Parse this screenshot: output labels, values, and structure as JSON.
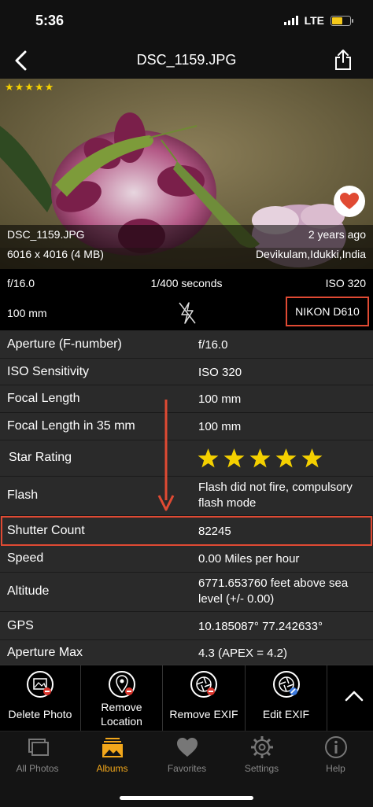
{
  "status_bar": {
    "time": "5:36",
    "network": "LTE",
    "battery_level": 0.6
  },
  "nav": {
    "title": "DSC_1159.JPG",
    "back_icon": "chevron-left-icon",
    "share_icon": "share-icon"
  },
  "photo": {
    "stars": "★★★★★",
    "filename": "DSC_1159.JPG",
    "dimensions": "6016 x 4016 (4 MB)",
    "age": "2 years ago",
    "location": "Devikulam,Idukki,India",
    "favorite_icon": "heart-icon"
  },
  "summary": {
    "aperture": "f/16.0",
    "shutter": "1/400 seconds",
    "iso": "ISO 320",
    "focal": "100 mm",
    "flash_icon": "flash-off-icon",
    "camera": "NIKON D610"
  },
  "exif": [
    {
      "label": "Aperture (F-number)",
      "value": "f/16.0"
    },
    {
      "label": "ISO Sensitivity",
      "value": "ISO 320"
    },
    {
      "label": "Focal Length",
      "value": "100 mm"
    },
    {
      "label": "Focal Length in 35 mm",
      "value": "100 mm"
    },
    {
      "label": "Star Rating",
      "value": "",
      "rating": 5,
      "rating_max": 5
    },
    {
      "label": "Flash",
      "value": "Flash did not fire, compulsory flash mode"
    },
    {
      "label": "Shutter Count",
      "value": "82245"
    },
    {
      "label": "Speed",
      "value": "0.00 Miles per hour"
    },
    {
      "label": "Altitude",
      "value": "6771.653760 feet above sea level (+/- 0.00)"
    },
    {
      "label": "GPS",
      "value": "10.185087° 77.242633°"
    },
    {
      "label": "Aperture Max",
      "value": "4.3 (APEX = 4.2)"
    }
  ],
  "actions": [
    {
      "label": "Delete Photo",
      "icon": "delete-photo-icon"
    },
    {
      "label": "Remove Location",
      "icon": "remove-location-icon"
    },
    {
      "label": "Remove EXIF",
      "icon": "remove-exif-icon"
    },
    {
      "label": "Edit EXIF",
      "icon": "edit-exif-icon"
    }
  ],
  "tabs": [
    {
      "label": "All Photos",
      "icon": "all-photos-icon",
      "active": false
    },
    {
      "label": "Albums",
      "icon": "albums-icon",
      "active": true
    },
    {
      "label": "Favorites",
      "icon": "heart-icon",
      "active": false
    },
    {
      "label": "Settings",
      "icon": "gear-icon",
      "active": false
    },
    {
      "label": "Help",
      "icon": "info-icon",
      "active": false
    }
  ],
  "colors": {
    "accent": "#f2a71b",
    "highlight": "#e04a33",
    "star": "#f4d000"
  }
}
